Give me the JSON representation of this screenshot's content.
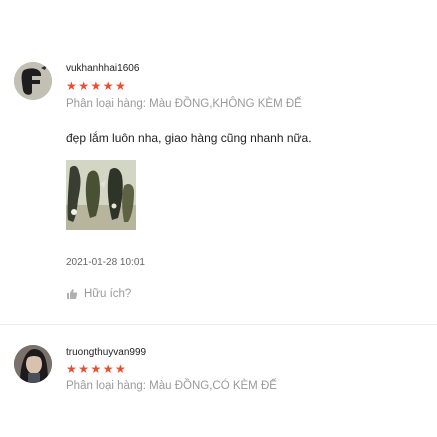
{
  "reviews": [
    {
      "username": "vukhanhhai1606",
      "rating": 5,
      "stars": "★★★★★",
      "variation": "Phân loại hàng: Màu ĐỒNG,KHÔNG KÈM ĐẾ",
      "comment": "đẹp lắm luôn nha, giao hàng cũng nhanh nữa.",
      "timestamp": "2021-01-28 10:01",
      "helpful_label": "Hữu ích?"
    },
    {
      "username": "truongthuyvan999",
      "rating": 5,
      "stars": "★★★★★",
      "variation": "Phân loại hàng: Màu ĐỒNG,CÓ KÈM ĐẾ"
    }
  ],
  "colors": {
    "star": "#ee4d2d",
    "muted": "#9a9a9a"
  },
  "icons": {
    "helpful": "thumbs-up-icon"
  }
}
